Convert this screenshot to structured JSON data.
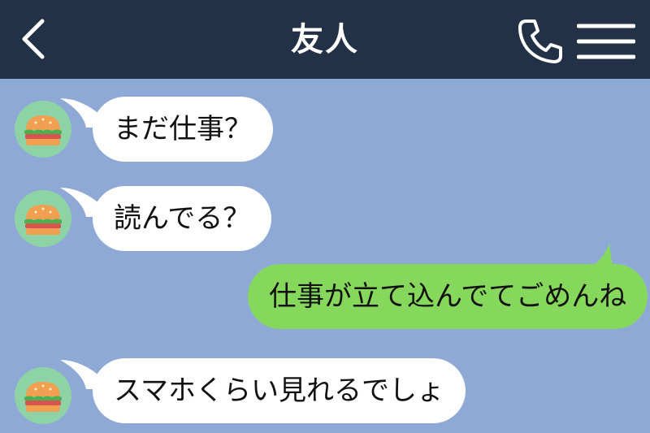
{
  "header": {
    "title": "友人",
    "back_icon": "chevron-left-icon",
    "call_icon": "phone-icon",
    "menu_icon": "hamburger-menu-icon"
  },
  "colors": {
    "header_bg": "#233147",
    "chat_bg": "#8fa9d6",
    "incoming_bubble": "#ffffff",
    "outgoing_bubble": "#86d85c",
    "avatar_bg": "#8ed3a5"
  },
  "messages": [
    {
      "from": "friend",
      "text": "まだ仕事？"
    },
    {
      "from": "friend",
      "text": "読んでる？"
    },
    {
      "from": "me",
      "text": "仕事が立て込んでてごめんね"
    },
    {
      "from": "friend",
      "text": "スマホくらい見れるでしょ"
    }
  ],
  "avatar_icon": "hamburger-food-icon"
}
